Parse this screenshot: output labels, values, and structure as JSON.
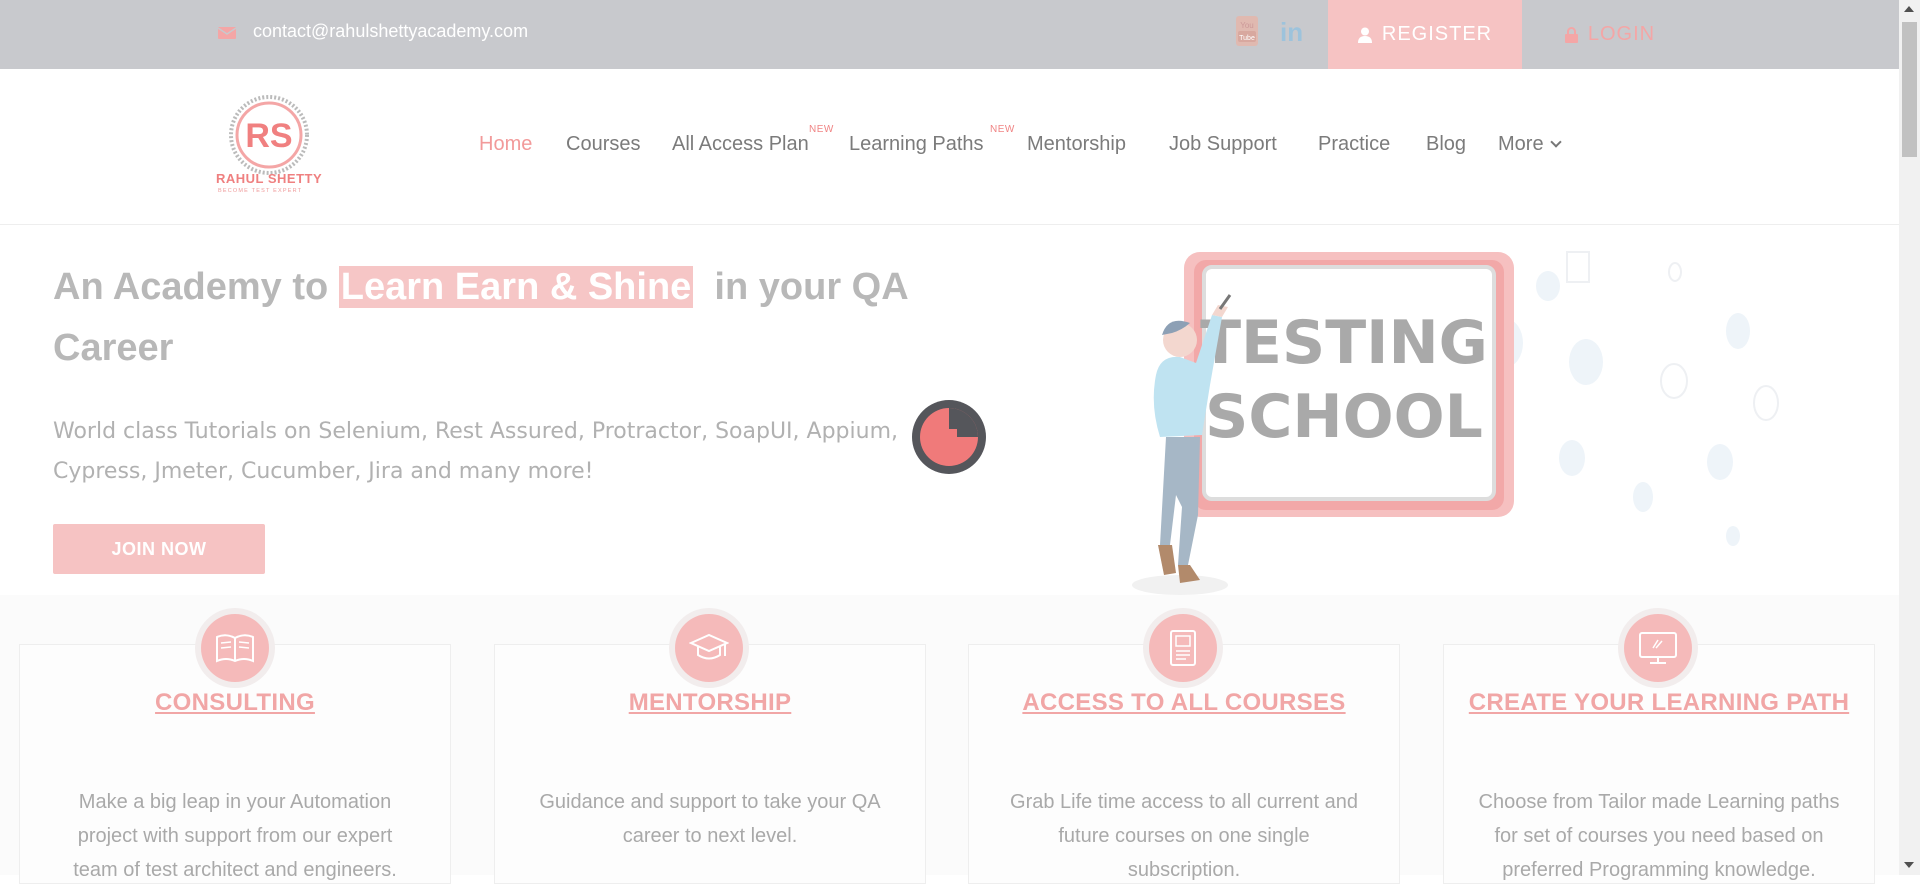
{
  "topbar": {
    "email": "contact@rahulshettyacademy.com",
    "icons": [
      "mail-icon",
      "youtube-icon",
      "linkedin-icon",
      "user-icon",
      "lock-icon"
    ],
    "linkedin_label": "in",
    "register_label": "REGISTER",
    "login_label": "LOGIN"
  },
  "logo": {
    "text": "RAHUL SHETTY",
    "subtext": "BECOME TEST EXPERT"
  },
  "nav": {
    "items": [
      {
        "label": "Home",
        "active": true
      },
      {
        "label": "Courses"
      },
      {
        "label": "All Access Plan",
        "badge": "NEW"
      },
      {
        "label": "Learning Paths",
        "badge": "NEW"
      },
      {
        "label": "Mentorship"
      },
      {
        "label": "Job Support"
      },
      {
        "label": "Practice"
      },
      {
        "label": "Blog"
      },
      {
        "label": "More"
      }
    ]
  },
  "hero": {
    "title_pre": "An Academy to ",
    "title_highlight": "Learn Earn & Shine",
    "title_post": "  in your QA Career",
    "subtitle": "World class Tutorials on Selenium, Rest Assured, Protractor, SoapUI, Appium, Cypress, Jmeter, Cucumber, Jira and many more!",
    "cta": "JOIN NOW",
    "art_text_line1": "TESTING",
    "art_text_line2": "SCHOOL"
  },
  "features": [
    {
      "icon": "book-icon",
      "title": "CONSULTING",
      "desc": "Make a big leap in your Automation project with support from our expert team of test architect and engineers."
    },
    {
      "icon": "graduation-cap-icon",
      "title": "MENTORSHIP",
      "desc": "Guidance and support to take your QA career to next level."
    },
    {
      "icon": "courses-icon",
      "title": "ACCESS TO ALL COURSES",
      "desc": "Grab Life time access to all current and future courses on one single subscription."
    },
    {
      "icon": "monitor-icon",
      "title": "CREATE YOUR LEARNING PATH",
      "desc": "Choose from Tailor made Learning paths for set of courses you need based on preferred Programming knowledge."
    }
  ],
  "colors": {
    "topbar_bg": "#c8c9cd",
    "accent": "#f08080",
    "accent_light": "#f6c3c3"
  }
}
